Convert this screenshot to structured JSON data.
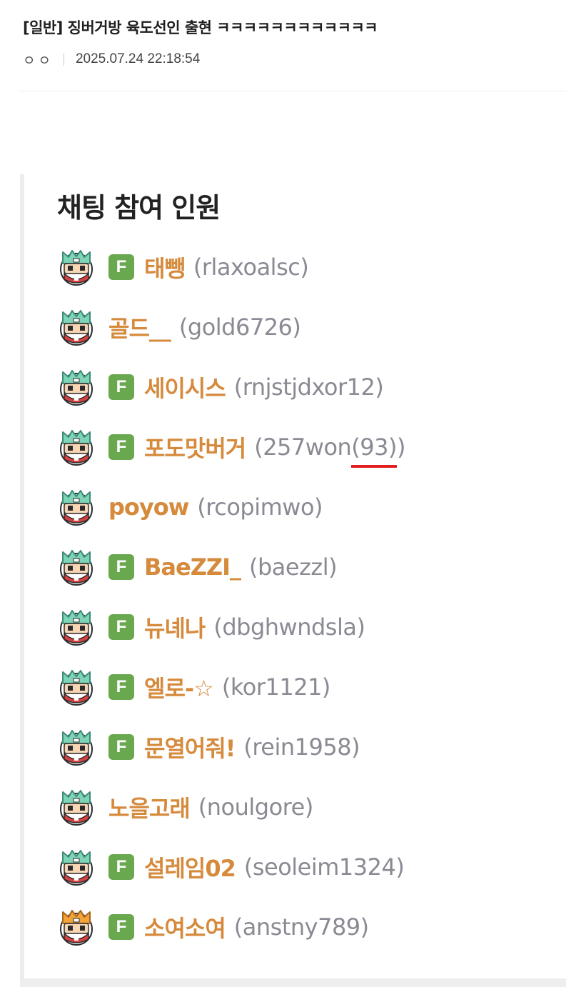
{
  "post": {
    "title": "[일반] 징버거방 육도선인 출현 ㅋㅋㅋㅋㅋㅋㅋㅋㅋㅋㅋㅋ",
    "author": "ㅇㅇ",
    "datetime": "2025.07.24 22:18:54"
  },
  "panel": {
    "title": "채팅 참여 인원"
  },
  "colors": {
    "nickname": "#d58a3c",
    "user_id": "#8a8a94",
    "fan_badge": "#6aa84f",
    "highlight_underline": "#e02020"
  },
  "members": [
    {
      "nickname": "태뺑",
      "id_prefix": "(rlaxoalsc)",
      "id_mark": "",
      "id_suffix": "",
      "fan_badge": "F",
      "avatar_icon": "crown-avatar-icon"
    },
    {
      "nickname": "골드__",
      "id_prefix": "(gold6726)",
      "id_mark": "",
      "id_suffix": "",
      "fan_badge": "",
      "avatar_icon": "crown-avatar-icon"
    },
    {
      "nickname": "세이시스",
      "id_prefix": "(rnjstjdxor12)",
      "id_mark": "",
      "id_suffix": "",
      "fan_badge": "F",
      "avatar_icon": "crown-avatar-icon"
    },
    {
      "nickname": "포도맛버거",
      "id_prefix": "(257won",
      "id_mark": "(93)",
      "id_suffix": ")",
      "fan_badge": "F",
      "avatar_icon": "crown-avatar-icon"
    },
    {
      "nickname": "poyow",
      "id_prefix": "(rcopimwo)",
      "id_mark": "",
      "id_suffix": "",
      "fan_badge": "",
      "avatar_icon": "crown-avatar-icon"
    },
    {
      "nickname": "BaeZZI_",
      "id_prefix": "(baezzl)",
      "id_mark": "",
      "id_suffix": "",
      "fan_badge": "F",
      "avatar_icon": "crown-avatar-icon"
    },
    {
      "nickname": "뉴녜나",
      "id_prefix": "(dbghwndsla)",
      "id_mark": "",
      "id_suffix": "",
      "fan_badge": "F",
      "avatar_icon": "crown-avatar-icon"
    },
    {
      "nickname": "엘로-☆",
      "id_prefix": "(kor1121)",
      "id_mark": "",
      "id_suffix": "",
      "fan_badge": "F",
      "avatar_icon": "crown-avatar-icon"
    },
    {
      "nickname": "문열어줘!",
      "id_prefix": "(rein1958)",
      "id_mark": "",
      "id_suffix": "",
      "fan_badge": "F",
      "avatar_icon": "crown-avatar-icon"
    },
    {
      "nickname": "노을고래",
      "id_prefix": "(noulgore)",
      "id_mark": "",
      "id_suffix": "",
      "fan_badge": "",
      "avatar_icon": "crown-avatar-icon"
    },
    {
      "nickname": "설레임02",
      "id_prefix": "(seoleim1324)",
      "id_mark": "",
      "id_suffix": "",
      "fan_badge": "F",
      "avatar_icon": "crown-avatar-icon"
    },
    {
      "nickname": "소여소여",
      "id_prefix": "(anstny789)",
      "id_mark": "",
      "id_suffix": "",
      "fan_badge": "F",
      "avatar_icon": "gold-crown-avatar-icon"
    }
  ]
}
